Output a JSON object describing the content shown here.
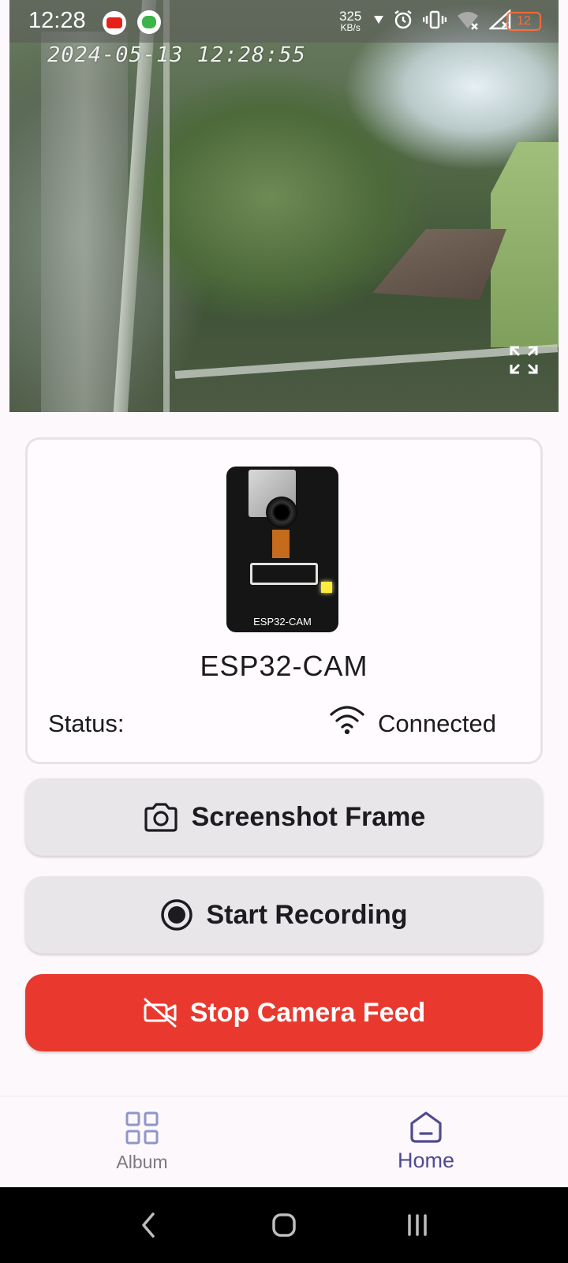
{
  "status_bar": {
    "time": "12:28",
    "net_speed_value": "325",
    "net_speed_unit": "KB/s",
    "battery": "12"
  },
  "camera_feed": {
    "timestamp": "2024-05-13 12:28:55"
  },
  "device_card": {
    "board_label": "ESP32-CAM",
    "device_name": "ESP32-CAM",
    "status_label": "Status:",
    "status_value": "Connected"
  },
  "actions": {
    "screenshot_label": "Screenshot Frame",
    "record_label": "Start Recording",
    "stop_label": "Stop Camera Feed"
  },
  "bottom_nav": {
    "album_label": "Album",
    "home_label": "Home",
    "active": "Home"
  },
  "colors": {
    "accent": "#4f4a91",
    "danger": "#e9392f",
    "button_bg": "#e9e6ea"
  }
}
